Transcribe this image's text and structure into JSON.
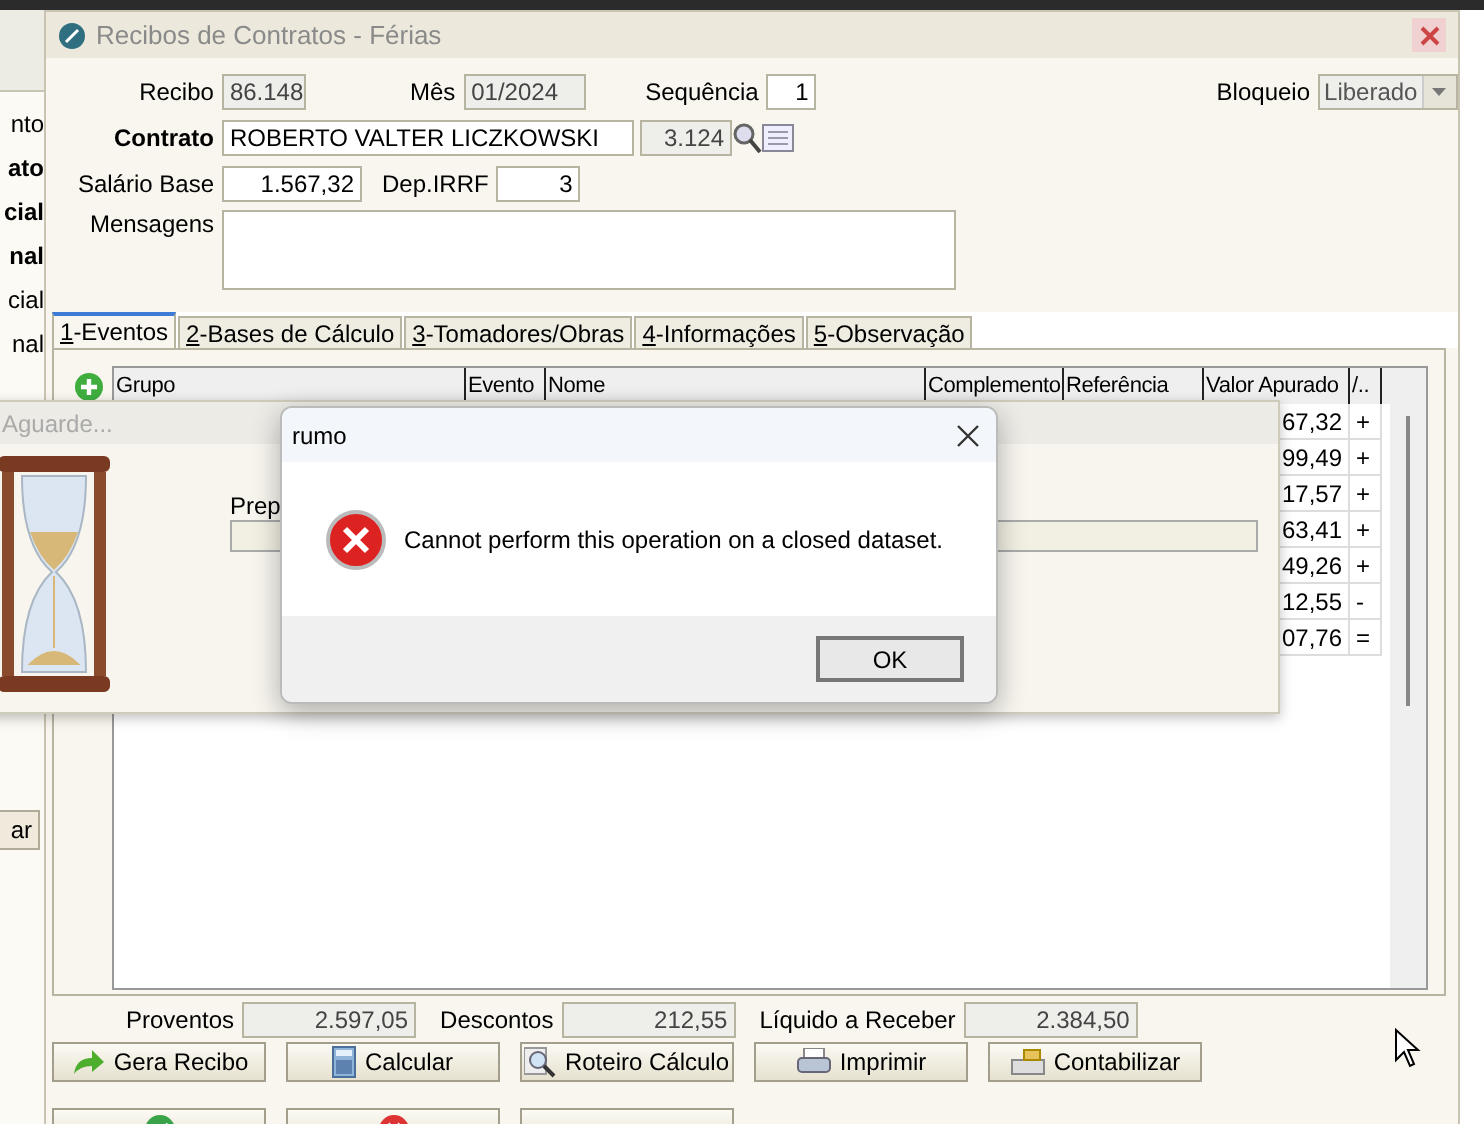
{
  "background_app": {
    "items": [
      {
        "text": "nto",
        "bold": false
      },
      {
        "text": "ato",
        "bold": true
      },
      {
        "text": "cial",
        "bold": true
      },
      {
        "text": "nal",
        "bold": true
      },
      {
        "text": "cial",
        "bold": false
      },
      {
        "text": "nal",
        "bold": false
      }
    ],
    "button": "ar"
  },
  "window": {
    "title": "Recibos de Contratos - Férias"
  },
  "form": {
    "recibo_label": "Recibo",
    "recibo": "86.148",
    "mes_label": "Mês",
    "mes": "01/2024",
    "sequencia_label": "Sequência",
    "sequencia": "1",
    "bloqueio_label": "Bloqueio",
    "bloqueio": "Liberado",
    "contrato_label": "Contrato",
    "contrato_nome": "ROBERTO VALTER LICZKOWSKI",
    "contrato_numero": "3.124",
    "salario_label": "Salário Base",
    "salario": "1.567,32",
    "dep_label": "Dep.IRRF",
    "dep": "3",
    "mensagens_label": "Mensagens"
  },
  "tabs": [
    {
      "key": "1",
      "label": "-Eventos",
      "selected": true
    },
    {
      "key": "2",
      "label": "-Bases de Cálculo",
      "selected": false
    },
    {
      "key": "3",
      "label": "-Tomadores/Obras",
      "selected": false
    },
    {
      "key": "4",
      "label": "-Informações",
      "selected": false
    },
    {
      "key": "5",
      "label": "-Observação",
      "selected": false
    }
  ],
  "table": {
    "columns": [
      "Grupo",
      "Evento",
      "Nome",
      "Complemento",
      "Referência",
      "Valor Apurado",
      "/.."
    ],
    "rows": [
      {
        "valor": "67,32",
        "sinal": "+"
      },
      {
        "valor": "99,49",
        "sinal": "+"
      },
      {
        "valor": "17,57",
        "sinal": "+"
      },
      {
        "valor": "63,41",
        "sinal": "+"
      },
      {
        "valor": "49,26",
        "sinal": "+"
      },
      {
        "valor": "12,55",
        "sinal": "-"
      },
      {
        "valor": "07,76",
        "sinal": "="
      }
    ]
  },
  "totals": [
    {
      "label": "Proventos",
      "value": "2.597,05"
    },
    {
      "label": "Descontos",
      "value": "212,55"
    },
    {
      "label": "Líquido a Receber",
      "value": "2.384,50"
    }
  ],
  "actions": [
    {
      "label": "Gera Recibo",
      "kind": "arrow"
    },
    {
      "label": "Calcular",
      "kind": "calculator"
    },
    {
      "label": "Roteiro Cálculo",
      "kind": "magnifier"
    },
    {
      "label": "Imprimir",
      "kind": "printer"
    },
    {
      "label": "Contabilizar",
      "kind": "register"
    }
  ],
  "actions_2": [
    {
      "kind": "check"
    },
    {
      "kind": "cancel"
    },
    {
      "kind": "none"
    }
  ],
  "progress_window": {
    "title": "Aguarde...",
    "label": "Prep",
    "level": 0
  },
  "dialog": {
    "title": "rumo",
    "message": "Cannot perform this operation on a closed dataset.",
    "button": "OK"
  }
}
